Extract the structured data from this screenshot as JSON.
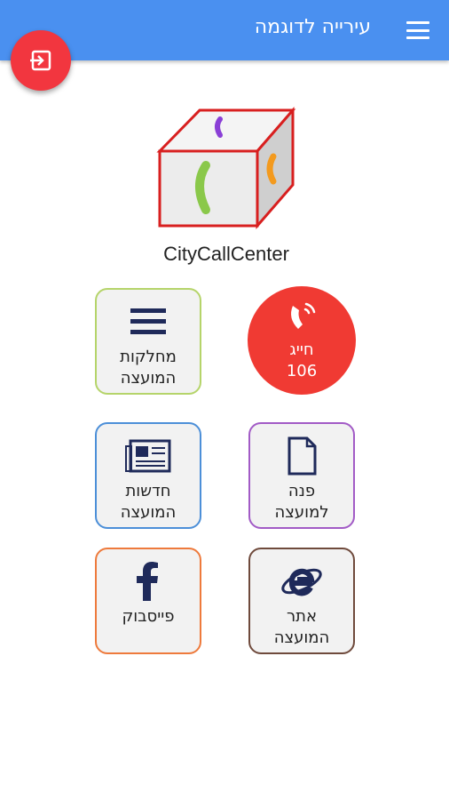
{
  "appbar": {
    "title": "עירייה לדוגמה"
  },
  "logo": {
    "text": "CityCallCenter"
  },
  "call": {
    "line1": "חייג",
    "line2": "106"
  },
  "tiles": {
    "departments": {
      "line1": "מחלקות",
      "line2": "המועצה"
    },
    "contact": {
      "line1": "פנה",
      "line2": "למועצה"
    },
    "news": {
      "line1": "חדשות",
      "line2": "המועצה"
    },
    "website": {
      "line1": "אתר",
      "line2": "המועצה"
    },
    "facebook": {
      "line1": "פייסבוק"
    }
  },
  "colors": {
    "appbar": "#4a90f0",
    "exit_fab": "#f2363f",
    "call": "#f03a33",
    "border_departments": "#b5d46a",
    "border_contact": "#a25bc6",
    "border_news": "#4c8fd8",
    "border_website": "#6f4a3c",
    "border_facebook": "#ee7a3c",
    "icon_navy": "#1f2a5a"
  }
}
